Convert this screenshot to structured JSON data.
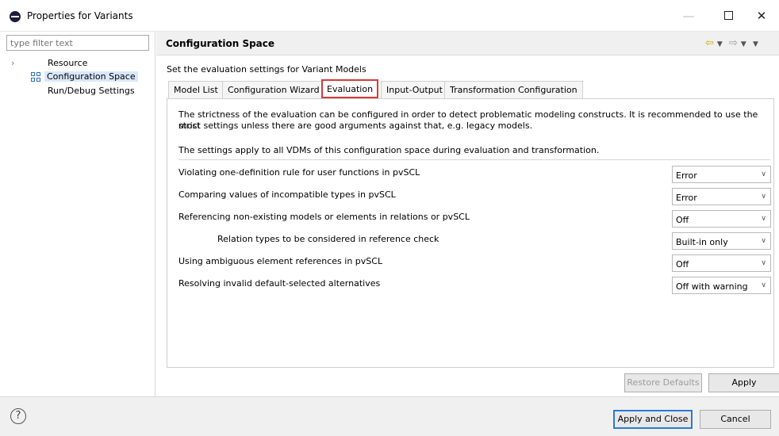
{
  "window": {
    "title": "Properties for Variants",
    "minimize_glyph": "—",
    "close_glyph": "✕"
  },
  "sidebar": {
    "filter_placeholder": "type filter text",
    "items": [
      {
        "label": "Resource"
      },
      {
        "label": "Configuration Space"
      },
      {
        "label": "Run/Debug Settings"
      }
    ]
  },
  "page": {
    "title": "Configuration Space",
    "description": "Set the evaluation settings for Variant Models"
  },
  "tabs": [
    {
      "label": "Model List"
    },
    {
      "label": "Configuration Wizard"
    },
    {
      "label": "Evaluation"
    },
    {
      "label": "Input-Output"
    },
    {
      "label": "Transformation Configuration"
    }
  ],
  "evaluation": {
    "intro_line1": "The strictness of the evaluation can be configured in order to detect problematic modeling constructs. It is recommended to use the most",
    "intro_line2": "strict settings unless there are good arguments against that, e.g. legacy models.",
    "intro_line3": "The settings apply to all VDMs of this configuration space during evaluation and transformation.",
    "settings": [
      {
        "label": "Violating one-definition rule for user functions in pvSCL",
        "value": "Error"
      },
      {
        "label": "Comparing values of incompatible types in pvSCL",
        "value": "Error"
      },
      {
        "label": "Referencing non-existing models or elements in relations or pvSCL",
        "value": "Off"
      },
      {
        "label": "Relation types to be considered in reference check",
        "value": "Built-in only"
      },
      {
        "label": "Using ambiguous element references in pvSCL",
        "value": "Off"
      },
      {
        "label": "Resolving invalid default-selected alternatives",
        "value": "Off with warning"
      }
    ]
  },
  "buttons": {
    "restore_defaults": "Restore Defaults",
    "apply": "Apply",
    "apply_and_close": "Apply and Close",
    "cancel": "Cancel",
    "help": "?"
  },
  "colors": {
    "active_tab_border": "#d43a3a",
    "primary_button_border": "#2a7bd4",
    "selection_bg": "#d9e8fb"
  }
}
